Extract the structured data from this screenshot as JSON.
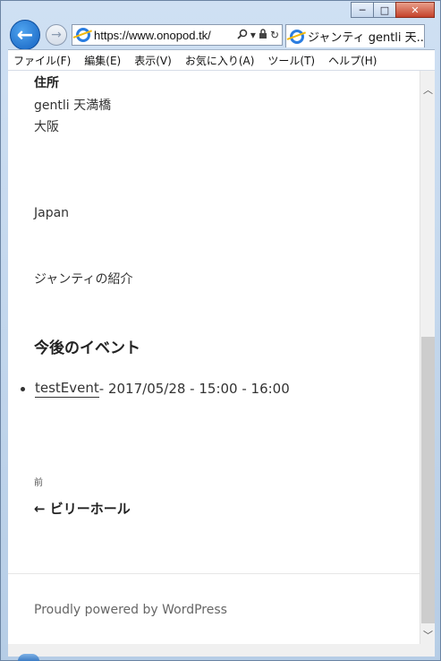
{
  "browser": {
    "address_url": "https://www.onopod.tk/",
    "tab_title": "ジャンティ gentli 天...",
    "icons": [
      "back-arrow-icon",
      "forward-arrow-icon",
      "ie-icon",
      "search-icon",
      "lock-icon",
      "refresh-icon",
      "close-icon"
    ],
    "caption": {
      "minimize": "─",
      "maximize": "□",
      "close": "✕"
    }
  },
  "menu": {
    "items": [
      "ファイル(F)",
      "編集(E)",
      "表示(V)",
      "お気に入り(A)",
      "ツール(T)",
      "ヘルプ(H)"
    ]
  },
  "page": {
    "address_heading": "住所",
    "address_lines": [
      "gentli 天満橋",
      "大阪",
      "Japan",
      "ジャンティの紹介"
    ],
    "events_heading": "今後のイベント",
    "event": {
      "name": "testEvent",
      "details": " - 2017/05/28 - 15:00 - 16:00"
    },
    "prev_label": "前",
    "prev_link": "← ビリーホール",
    "footer": "Proudly powered by WordPress"
  }
}
